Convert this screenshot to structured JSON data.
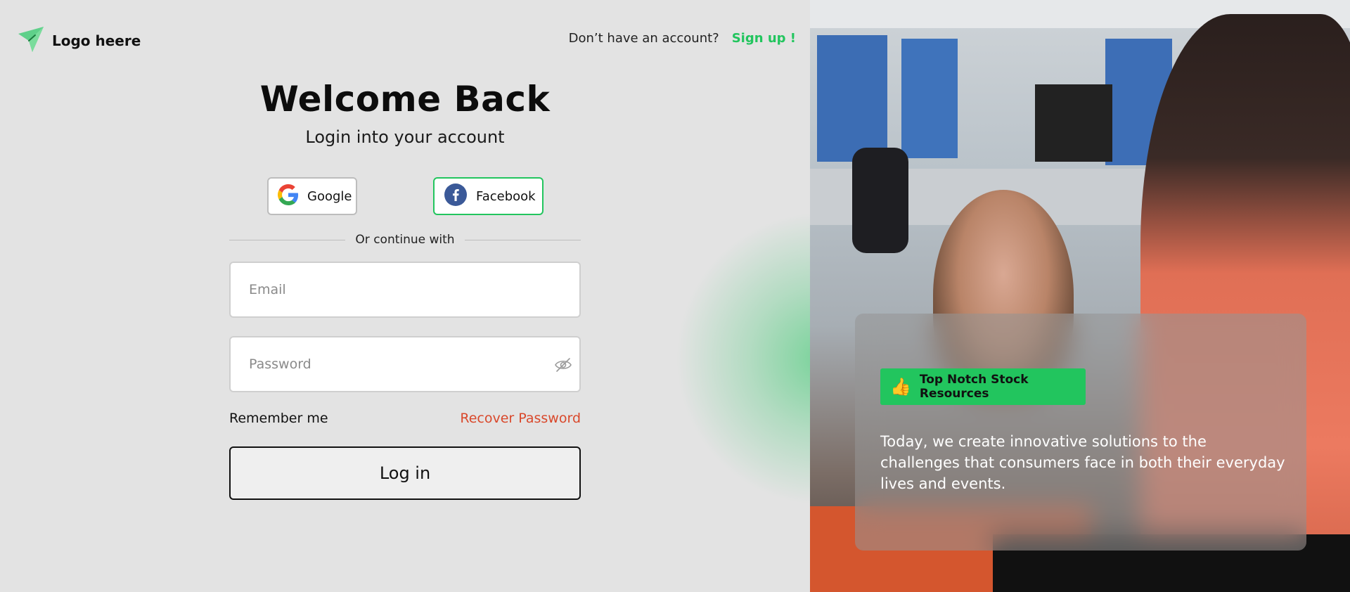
{
  "brand": {
    "logo_text": "Logo heere"
  },
  "header": {
    "question": "Don’t have an account?",
    "signup_label": "Sign up !"
  },
  "login": {
    "title": "Welcome Back",
    "subtitle": "Login into your account",
    "google_label": "Google",
    "facebook_label": "Facebook",
    "divider_text": "Or continue with",
    "email_placeholder": "Email",
    "password_placeholder": "Password",
    "remember_label": "Remember me",
    "recover_label": "Recover Password",
    "login_button": "Log in"
  },
  "promo": {
    "badge_icon": "thumbs-up-icon",
    "badge_label": "Top Notch Stock Resources",
    "text": "Today, we create innovative solutions to the challenges that consumers face in both their everyday lives and events."
  },
  "colors": {
    "accent": "#22c55e",
    "recover": "#d9482b",
    "background": "#e3e3e3"
  }
}
